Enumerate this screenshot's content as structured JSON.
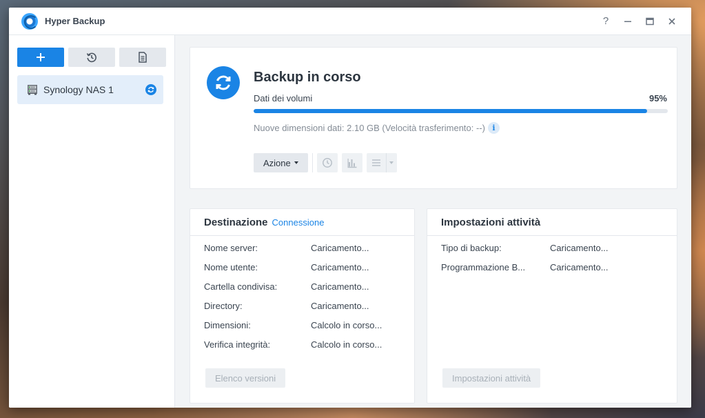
{
  "window": {
    "title": "Hyper Backup"
  },
  "titlebar": {
    "help": "?",
    "minimize": "—",
    "maximize": "▭",
    "close": "✕"
  },
  "sidebar": {
    "items": [
      {
        "label": "Synology NAS 1",
        "status": "syncing"
      }
    ]
  },
  "status": {
    "title": "Backup in corso",
    "progress_label": "Dati dei volumi",
    "progress_pct_text": "95%",
    "progress_fraction": 0.95,
    "detail": "Nuove dimensioni dati: 2.10 GB (Velocità trasferimento: --)",
    "info_glyph": "i",
    "action_label": "Azione"
  },
  "destination": {
    "title": "Destinazione",
    "link": "Connessione",
    "rows": [
      {
        "key": "Nome server:",
        "value": "Caricamento..."
      },
      {
        "key": "Nome utente:",
        "value": "Caricamento..."
      },
      {
        "key": "Cartella condivisa:",
        "value": "Caricamento..."
      },
      {
        "key": "Directory:",
        "value": "Caricamento..."
      },
      {
        "key": "Dimensioni:",
        "value": "Calcolo in corso..."
      },
      {
        "key": "Verifica integrità:",
        "value": "Calcolo in corso..."
      }
    ],
    "button": "Elenco versioni"
  },
  "task": {
    "title": "Impostazioni attività",
    "rows": [
      {
        "key": "Tipo di backup:",
        "value": "Caricamento..."
      },
      {
        "key": "Programmazione B...",
        "value": "Caricamento..."
      }
    ],
    "button": "Impostazioni attività"
  },
  "colors": {
    "accent": "#1a84e5",
    "selected_bg": "#e3eefa"
  }
}
